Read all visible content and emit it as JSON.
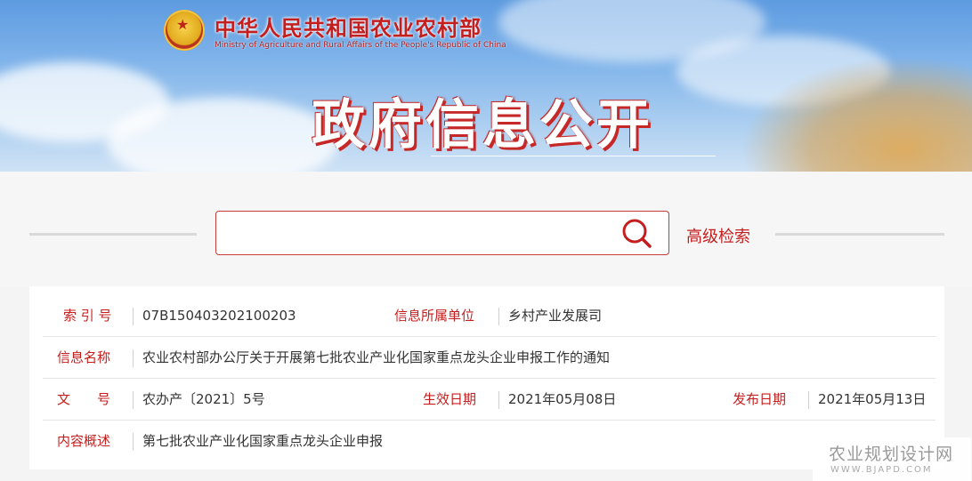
{
  "header": {
    "site_name_cn": "中华人民共和国农业农村部",
    "site_name_en": "Ministry of Agriculture and Rural Affairs of the People's Republic of China",
    "banner_title": "政府信息公开"
  },
  "search": {
    "value": "",
    "placeholder": "",
    "advanced_label": "高级检索"
  },
  "info": {
    "index_label": "索 引 号",
    "index_value": "07B150403202100203",
    "dept_label": "信息所属单位",
    "dept_value": "乡村产业发展司",
    "name_label": "信息名称",
    "name_value": "农业农村部办公厅关于开展第七批农业产业化国家重点龙头企业申报工作的通知",
    "doc_label": "文　　号",
    "doc_value": "农办产〔2021〕5号",
    "effective_label": "生效日期",
    "effective_value": "2021年05月08日",
    "publish_label": "发布日期",
    "publish_value": "2021年05月13日",
    "summary_label": "内容概述",
    "summary_value": "第七批农业产业化国家重点龙头企业申报"
  },
  "watermark": {
    "cn": "农业规划设计网",
    "en": "WWW.BJAPD.COM"
  },
  "colors": {
    "accent_red": "#c41e1e",
    "border_red": "#c93a3a",
    "sky_blue": "#7fb3ea"
  }
}
